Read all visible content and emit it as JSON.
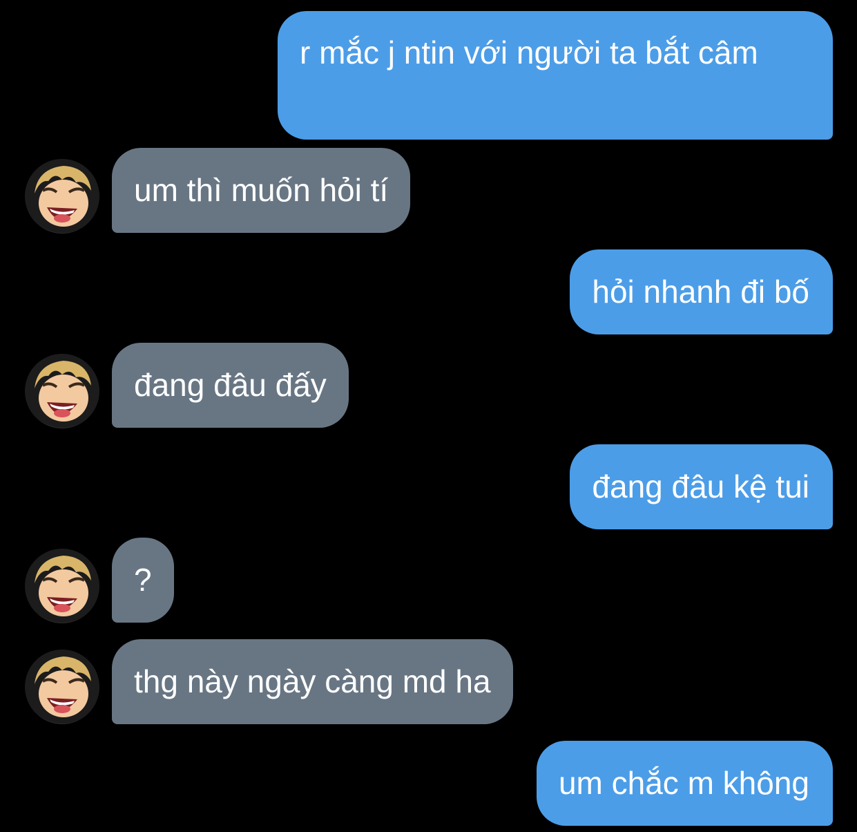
{
  "messages": [
    {
      "sender": "me",
      "text": "r mắc j ntin với người ta bắt câm"
    },
    {
      "sender": "them",
      "text": "um thì muốn hỏi tí"
    },
    {
      "sender": "me",
      "text": "hỏi nhanh đi bố"
    },
    {
      "sender": "them",
      "text": "đang đâu đấy"
    },
    {
      "sender": "me",
      "text": "đang đâu kệ tui"
    },
    {
      "sender": "them",
      "text": "?"
    },
    {
      "sender": "them",
      "text": "thg này ngày càng md ha"
    },
    {
      "sender": "me",
      "text": "um chắc m không"
    }
  ],
  "colors": {
    "outgoing_bubble": "#4c9de8",
    "incoming_bubble": "#687684",
    "background": "#000000"
  },
  "avatar": {
    "icon": "anime-laughing-boy-avatar"
  }
}
